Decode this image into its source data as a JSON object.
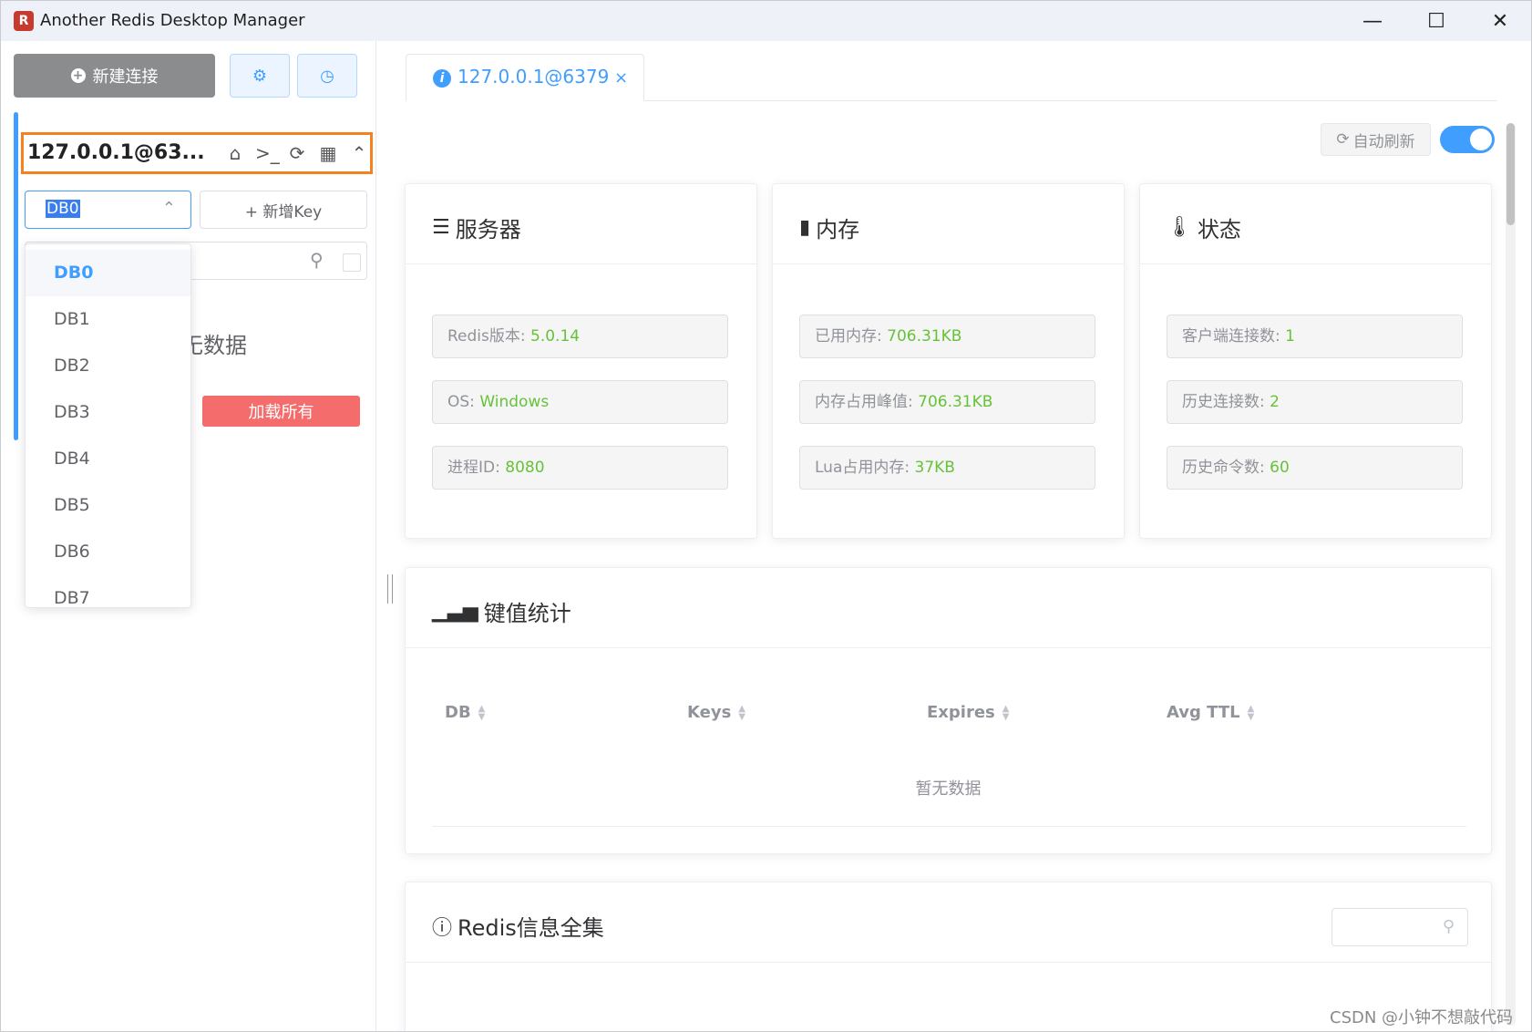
{
  "window": {
    "app_icon_glyph": "R",
    "title": "Another Redis Desktop Manager",
    "minimize_glyph": "—",
    "maximize_glyph": "☐",
    "close_glyph": "✕"
  },
  "sidebar": {
    "new_connection_label": "新建连接",
    "settings_icon": "gear-icon",
    "history_icon": "clock-icon",
    "connection": {
      "name": "127.0.0.1@63...",
      "icons": [
        "home-icon",
        "terminal-icon",
        "refresh-icon",
        "grid-icon",
        "chevron-up-icon"
      ]
    },
    "db_select": {
      "value": "DB0"
    },
    "new_key_label": "+ 新增Key",
    "no_data_partial": "无数据",
    "load_all_label": "加载所有",
    "db_options": [
      "DB0",
      "DB1",
      "DB2",
      "DB3",
      "DB4",
      "DB5",
      "DB6",
      "DB7"
    ],
    "db_selected_index": 0
  },
  "tab": {
    "label": "127.0.0.1@6379",
    "close_glyph": "×"
  },
  "toolbar": {
    "auto_refresh_label": "自动刷新",
    "auto_refresh_on": true
  },
  "server_card": {
    "title": "服务器",
    "items": [
      {
        "label": "Redis版本:",
        "value": "5.0.14"
      },
      {
        "label": "OS:",
        "value": "Windows"
      },
      {
        "label": "进程ID:",
        "value": "8080"
      }
    ]
  },
  "memory_card": {
    "title": "内存",
    "items": [
      {
        "label": "已用内存:",
        "value": "706.31KB"
      },
      {
        "label": "内存占用峰值:",
        "value": "706.31KB"
      },
      {
        "label": "Lua占用内存:",
        "value": "37KB"
      }
    ]
  },
  "status_card": {
    "title": "状态",
    "items": [
      {
        "label": "客户端连接数:",
        "value": "1"
      },
      {
        "label": "历史连接数:",
        "value": "2"
      },
      {
        "label": "历史命令数:",
        "value": "60"
      }
    ]
  },
  "keys_card": {
    "title": "键值统计",
    "columns": [
      "DB",
      "Keys",
      "Expires",
      "Avg TTL"
    ],
    "empty_text": "暂无数据"
  },
  "info_card": {
    "title": "Redis信息全集"
  },
  "watermark": "CSDN @小钟不想敲代码",
  "colors": {
    "accent": "#409eff",
    "value_green": "#67c23a",
    "danger": "#f56c6c",
    "highlight_border": "#f5821f"
  }
}
